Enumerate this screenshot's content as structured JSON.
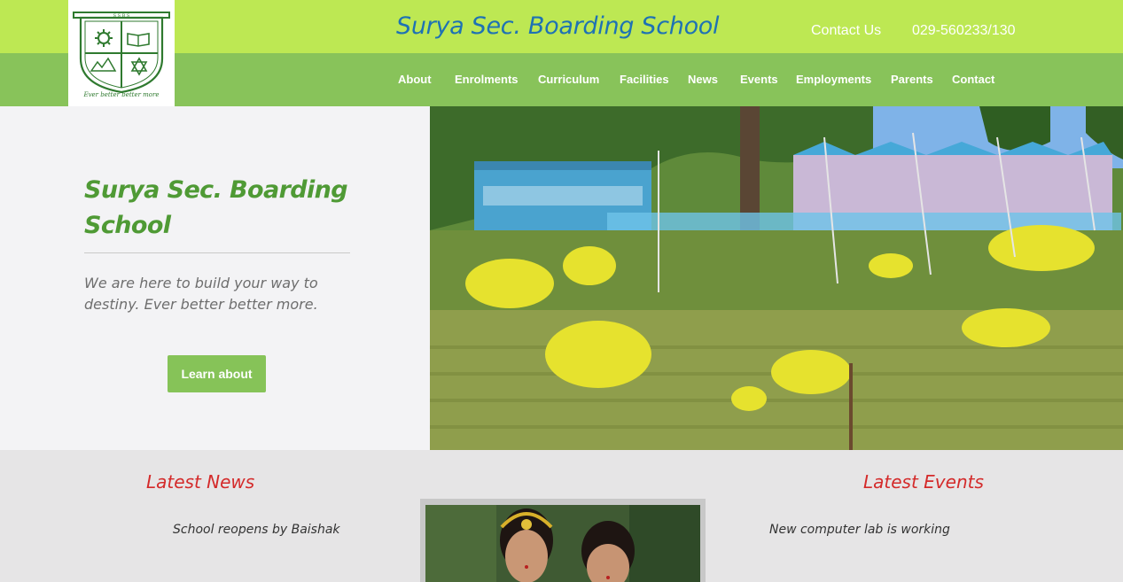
{
  "header": {
    "logo_motto": "Ever better better more",
    "logo_initials": "S S B S",
    "site_title": "Surya Sec. Boarding School",
    "contact_link": "Contact Us",
    "phone": "029-560233/130"
  },
  "nav": {
    "items": [
      "About",
      "Enrolments",
      "Curriculum",
      "Facilities",
      "News",
      "Events",
      "Employments",
      "Parents",
      "Contact"
    ]
  },
  "hero": {
    "title": "Surya Sec. Boarding School",
    "tagline": "We are here to build your way to destiny. Ever better better more.",
    "button_label": "Learn about"
  },
  "news": {
    "heading": "Latest News",
    "items": [
      "School reopens by Baishak"
    ]
  },
  "events": {
    "heading": "Latest Events",
    "items": [
      "New computer lab is working"
    ]
  },
  "colors": {
    "top_bar": "#bde853",
    "nav_bar": "#88c35a",
    "title_blue": "#1e72b4",
    "hero_title_green": "#4f9a35",
    "button_green": "#86c358",
    "section_heading_red": "#d42a2a",
    "section_bg": "#e6e5e6"
  }
}
